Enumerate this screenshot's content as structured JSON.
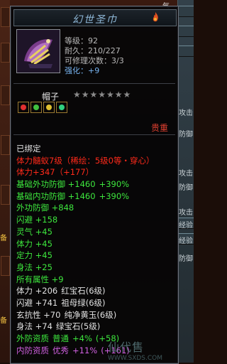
{
  "item": {
    "name": "幻世圣巾",
    "level": "等级：92",
    "durability": "耐久：210/227",
    "repairs": "可修理次数：3/3",
    "enhance_label": "强化：",
    "enhance_value": "+9",
    "type": "帽子",
    "stars": "★★★★★★★",
    "binding_note": "贵重"
  },
  "tooltip_lines": [
    {
      "cls": "w",
      "parts": [
        "已绑定"
      ]
    },
    {
      "cls": "r",
      "parts": [
        "体力髓蚁7级（稀绘：5级0等・穿心）"
      ]
    },
    {
      "cls": "r",
      "parts": [
        "体力+347（+177）"
      ]
    },
    {
      "cls": "g",
      "parts": [
        "基础外功防御 +1460",
        "+390%"
      ]
    },
    {
      "cls": "g",
      "parts": [
        "基础内功防御 +1460",
        "+390%"
      ]
    },
    {
      "cls": "g",
      "parts": [
        "外功防御 +848"
      ]
    },
    {
      "cls": "g",
      "parts": [
        "闪避 +158"
      ]
    },
    {
      "cls": "g",
      "parts": [
        "灵气 +45"
      ]
    },
    {
      "cls": "g",
      "parts": [
        "体力 +45"
      ]
    },
    {
      "cls": "g",
      "parts": [
        "定力 +45"
      ]
    },
    {
      "cls": "g",
      "parts": [
        "身法 +25"
      ]
    },
    {
      "cls": "g",
      "parts": [
        "所有属性 +9"
      ]
    },
    {
      "cls": "w",
      "parts": [
        "体力 +206",
        "红宝石(6级)"
      ]
    },
    {
      "cls": "w",
      "parts": [
        "闪避 +741",
        "祖母绿(6级)"
      ]
    },
    {
      "cls": "w",
      "parts": [
        "玄抗性 +70",
        "纯净黄玉(6级)"
      ]
    },
    {
      "cls": "w",
      "parts": [
        "身法 +74",
        "绿宝石(5级)"
      ]
    },
    {
      "cls": "g",
      "parts": [
        "外防资质",
        "普通",
        "+4%",
        "(+58)"
      ]
    },
    {
      "cls": "p",
      "parts": [
        "内防资质",
        "优秀",
        "+11%",
        "(+161)"
      ]
    }
  ],
  "side": {
    "top_word": "气",
    "right_tabs": [
      "攻击",
      "防御",
      "攻击",
      "防御",
      "攻击",
      "经验",
      "经验",
      "防御"
    ],
    "left_labels": [
      "备",
      "备"
    ]
  },
  "watermark": {
    "big": "仙代售",
    "small": "WWW.SXDS.COM"
  },
  "colors": {
    "title": "#8fb8d8",
    "red": "#ff2a1a",
    "green": "#3de63d",
    "purple": "#d060e0",
    "blue": "#78b4f0"
  }
}
